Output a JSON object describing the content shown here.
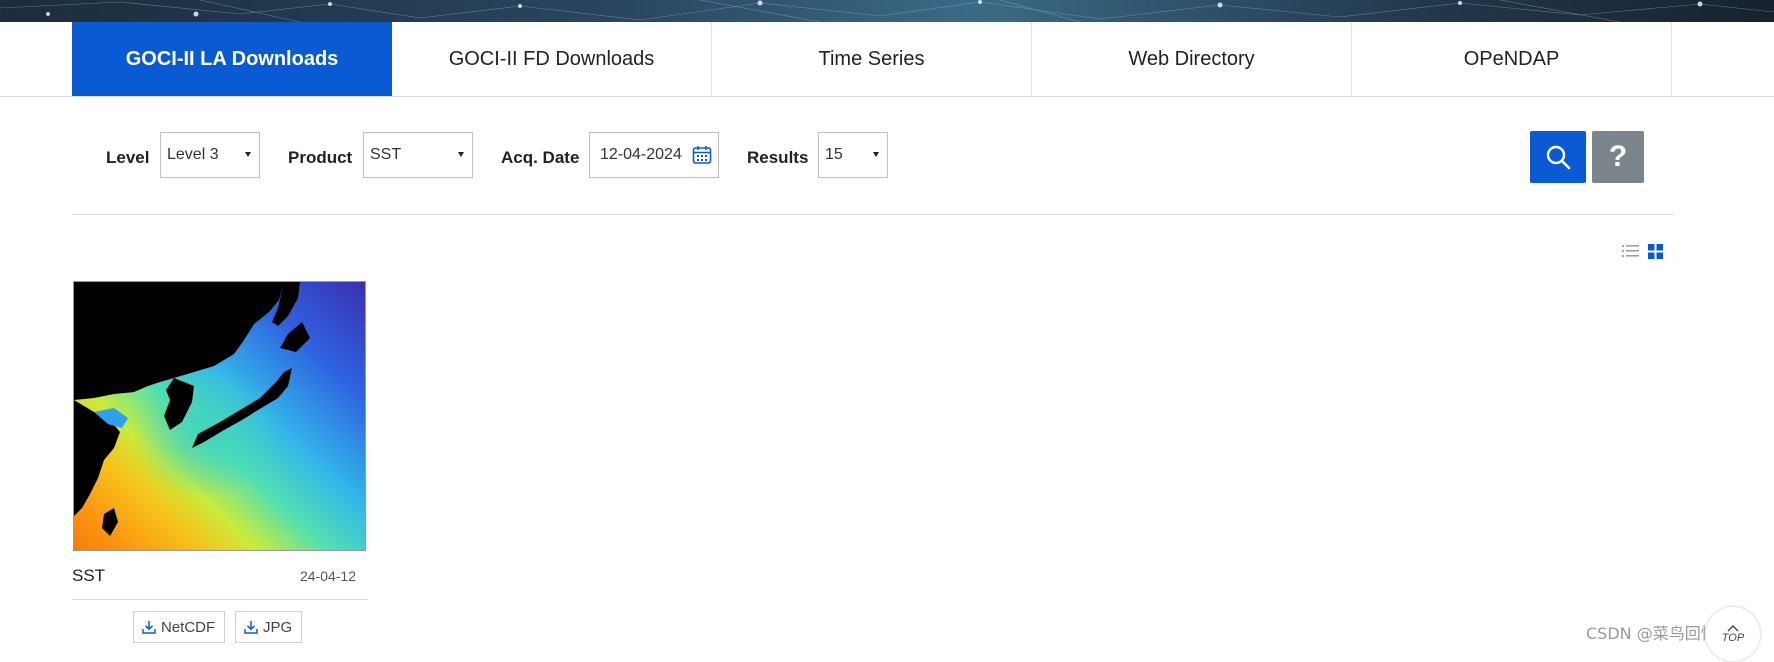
{
  "tabs": [
    {
      "label": "GOCI-II LA Downloads",
      "active": true
    },
    {
      "label": "GOCI-II FD Downloads",
      "active": false
    },
    {
      "label": "Time Series",
      "active": false
    },
    {
      "label": "Web Directory",
      "active": false
    },
    {
      "label": "OPeNDAP",
      "active": false
    }
  ],
  "search": {
    "level_label": "Level",
    "level_value": "Level 3",
    "product_label": "Product",
    "product_value": "SST",
    "date_label": "Acq. Date",
    "date_value": "12-04-2024",
    "results_label": "Results",
    "results_value": "15",
    "help_label": "?"
  },
  "results": [
    {
      "title": "SST",
      "date": "24-04-12",
      "downloads": [
        "NetCDF",
        "JPG"
      ]
    }
  ],
  "footer": {
    "watermark": "CSDN @菜鸟回忆录",
    "top_label": "TOP"
  },
  "colors": {
    "primary": "#0a5bd3",
    "help_button": "#7d858c"
  },
  "icons": {
    "search": "search-icon",
    "calendar": "calendar-icon",
    "list_view": "list-view-icon",
    "grid_view": "grid-view-icon",
    "download": "download-icon",
    "top": "arrow-up-icon"
  }
}
